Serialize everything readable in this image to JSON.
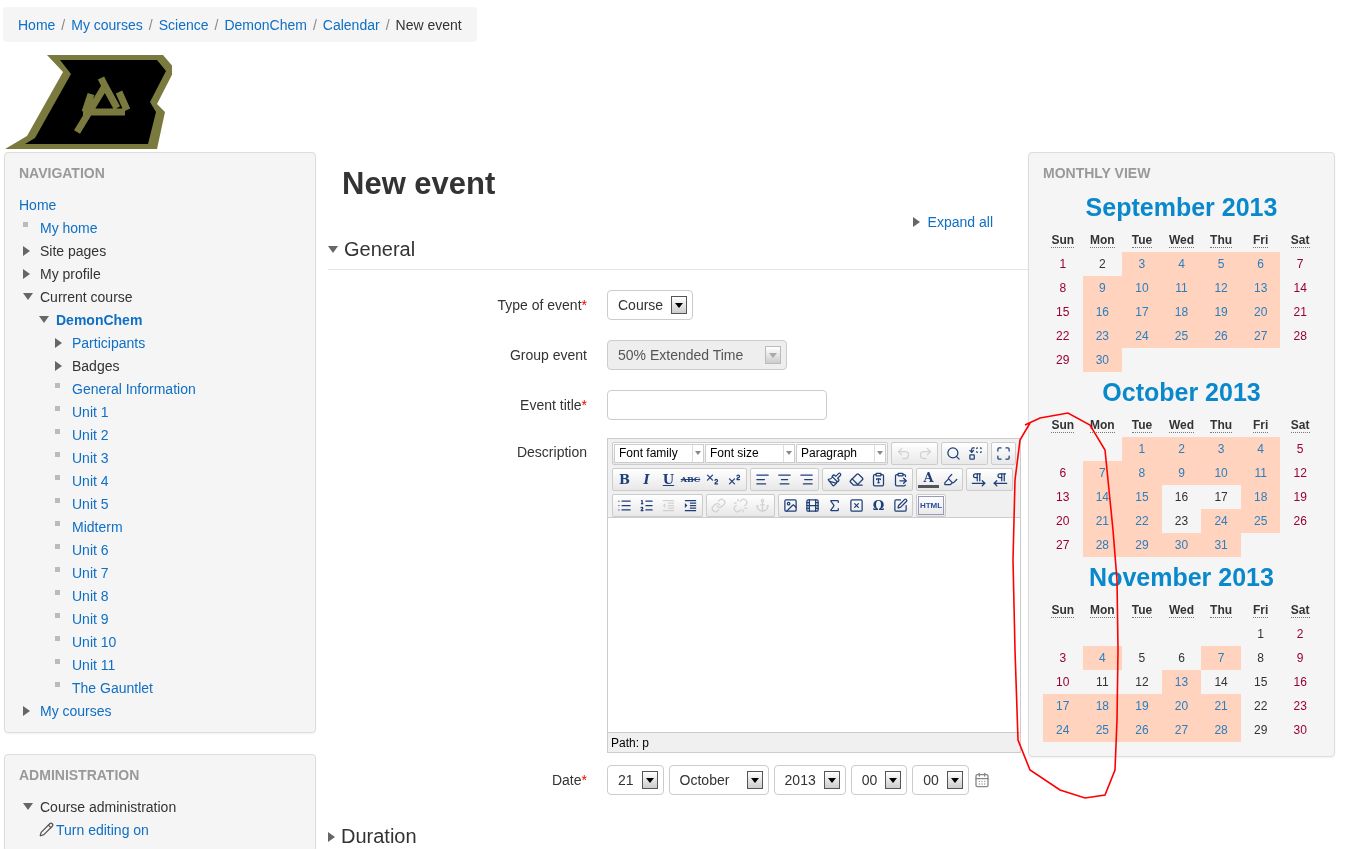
{
  "breadcrumb": {
    "separator": "/",
    "items": [
      {
        "label": "Home",
        "link": true
      },
      {
        "label": "My courses",
        "link": true
      },
      {
        "label": "Science",
        "link": true
      },
      {
        "label": "DemonChem",
        "link": true
      },
      {
        "label": "Calendar",
        "link": true
      },
      {
        "label": "New event",
        "link": false
      }
    ]
  },
  "navigation": {
    "title": "NAVIGATION",
    "items": [
      {
        "label": "Home",
        "link": true,
        "kind": "plain"
      },
      {
        "label": "My home",
        "link": true,
        "kind": "leaf"
      },
      {
        "label": "Site pages",
        "link": false,
        "kind": "branch",
        "expanded": false
      },
      {
        "label": "My profile",
        "link": false,
        "kind": "branch",
        "expanded": false
      },
      {
        "label": "Current course",
        "link": false,
        "kind": "branch",
        "expanded": true,
        "children": [
          {
            "label": "DemonChem",
            "link": true,
            "kind": "branch",
            "expanded": true,
            "children": [
              {
                "label": "Participants",
                "link": true,
                "kind": "branch",
                "expanded": false
              },
              {
                "label": "Badges",
                "link": false,
                "kind": "branch",
                "expanded": false
              },
              {
                "label": "General Information",
                "link": true,
                "kind": "leaf"
              },
              {
                "label": "Unit 1",
                "link": true,
                "kind": "leaf"
              },
              {
                "label": "Unit 2",
                "link": true,
                "kind": "leaf"
              },
              {
                "label": "Unit 3",
                "link": true,
                "kind": "leaf"
              },
              {
                "label": "Unit 4",
                "link": true,
                "kind": "leaf"
              },
              {
                "label": "Unit 5",
                "link": true,
                "kind": "leaf"
              },
              {
                "label": "Midterm",
                "link": true,
                "kind": "leaf"
              },
              {
                "label": "Unit 6",
                "link": true,
                "kind": "leaf"
              },
              {
                "label": "Unit 7",
                "link": true,
                "kind": "leaf"
              },
              {
                "label": "Unit 8",
                "link": true,
                "kind": "leaf"
              },
              {
                "label": "Unit 9",
                "link": true,
                "kind": "leaf"
              },
              {
                "label": "Unit 10",
                "link": true,
                "kind": "leaf"
              },
              {
                "label": "Unit 11",
                "link": true,
                "kind": "leaf"
              },
              {
                "label": "The Gauntlet",
                "link": true,
                "kind": "leaf"
              }
            ]
          }
        ]
      },
      {
        "label": "My courses",
        "link": true,
        "kind": "branch",
        "expanded": false
      }
    ]
  },
  "administration": {
    "title": "ADMINISTRATION",
    "items": [
      {
        "label": "Course administration",
        "link": false,
        "kind": "branch",
        "expanded": true,
        "children": [
          {
            "label": "Turn editing on",
            "link": true,
            "kind": "action"
          }
        ]
      }
    ]
  },
  "page_title": "New event",
  "expand_all": "Expand all",
  "general": {
    "title": "General",
    "expanded": true,
    "fields": [
      {
        "kind": "select",
        "label": "Type of event",
        "required_mark": "*",
        "value": "Course",
        "disabled": false
      },
      {
        "kind": "select",
        "label": "Group event",
        "value": "50% Extended Time",
        "disabled": true
      },
      {
        "kind": "text",
        "label": "Event title",
        "required_mark": "*"
      },
      {
        "kind": "editor",
        "label": "Description",
        "path": "Path: p",
        "toolbar": [
          [
            [
              {
                "kind": "dropdown",
                "label": "Font family",
                "disabled": false
              },
              {
                "kind": "dropdown",
                "label": "Font size",
                "disabled": false
              },
              {
                "kind": "dropdown",
                "label": "Paragraph",
                "disabled": false
              }
            ],
            [
              {
                "kind": "undo",
                "disabled": true
              },
              {
                "kind": "redo",
                "disabled": true
              }
            ],
            [
              {
                "kind": "find",
                "disabled": false
              },
              {
                "kind": "replace",
                "disabled": false
              }
            ],
            [
              {
                "kind": "fullscreen",
                "disabled": false
              }
            ]
          ],
          [
            [
              {
                "kind": "bold",
                "label": "B",
                "disabled": false
              },
              {
                "kind": "italic",
                "label": "I",
                "disabled": false
              },
              {
                "kind": "underline",
                "label": "U",
                "disabled": false
              },
              {
                "kind": "strike",
                "label": "ABC",
                "disabled": false
              },
              {
                "kind": "subscript",
                "disabled": false
              },
              {
                "kind": "superscript",
                "disabled": false
              }
            ],
            [
              {
                "kind": "align-left",
                "disabled": false
              },
              {
                "kind": "align-center",
                "disabled": false
              },
              {
                "kind": "align-right",
                "disabled": false
              }
            ],
            [
              {
                "kind": "cleanup",
                "disabled": false
              },
              {
                "kind": "eraser",
                "disabled": false
              },
              {
                "kind": "paste-text",
                "disabled": false
              },
              {
                "kind": "paste-word",
                "disabled": false
              }
            ],
            [
              {
                "kind": "forecolor",
                "label": "A",
                "disabled": false
              },
              {
                "kind": "highlight",
                "disabled": false
              }
            ],
            [
              {
                "kind": "ltr",
                "disabled": false
              },
              {
                "kind": "rtl",
                "disabled": false
              }
            ]
          ],
          [
            [
              {
                "kind": "bullets",
                "disabled": false
              },
              {
                "kind": "numbers",
                "disabled": false
              },
              {
                "kind": "outdent",
                "disabled": true
              },
              {
                "kind": "indent",
                "disabled": false
              }
            ],
            [
              {
                "kind": "link",
                "disabled": true
              },
              {
                "kind": "unlink",
                "disabled": true
              },
              {
                "kind": "anchor",
                "disabled": true
              }
            ],
            [
              {
                "kind": "image",
                "disabled": false
              },
              {
                "kind": "media",
                "disabled": false
              },
              {
                "kind": "equation",
                "disabled": false
              },
              {
                "kind": "nolink",
                "disabled": false
              },
              {
                "kind": "charmap",
                "label": "Ω",
                "disabled": false
              },
              {
                "kind": "edit",
                "disabled": false
              }
            ],
            [
              {
                "kind": "html",
                "label": "HTML",
                "disabled": false
              }
            ]
          ]
        ]
      },
      {
        "kind": "date",
        "label": "Date",
        "required_mark": "*",
        "parts": [
          "21",
          "October",
          "2013",
          "00",
          "00"
        ]
      }
    ]
  },
  "duration": {
    "title": "Duration",
    "expanded": false
  },
  "monthly_view": {
    "title": "MONTHLY VIEW",
    "months": [
      {
        "title": "September 2013",
        "weekdays": [
          "Sun",
          "Mon",
          "Tue",
          "Wed",
          "Thu",
          "Fri",
          "Sat"
        ],
        "weeks": [
          [
            {
              "day": "1",
              "event": false
            },
            {
              "day": "2",
              "event": false
            },
            {
              "day": "3",
              "event": true
            },
            {
              "day": "4",
              "event": true
            },
            {
              "day": "5",
              "event": true
            },
            {
              "day": "6",
              "event": true
            },
            {
              "day": "7",
              "event": false
            }
          ],
          [
            {
              "day": "8",
              "event": false
            },
            {
              "day": "9",
              "event": true
            },
            {
              "day": "10",
              "event": true
            },
            {
              "day": "11",
              "event": true
            },
            {
              "day": "12",
              "event": true
            },
            {
              "day": "13",
              "event": true
            },
            {
              "day": "14",
              "event": false
            }
          ],
          [
            {
              "day": "15",
              "event": false
            },
            {
              "day": "16",
              "event": true
            },
            {
              "day": "17",
              "event": true
            },
            {
              "day": "18",
              "event": true
            },
            {
              "day": "19",
              "event": true
            },
            {
              "day": "20",
              "event": true
            },
            {
              "day": "21",
              "event": false
            }
          ],
          [
            {
              "day": "22",
              "event": false
            },
            {
              "day": "23",
              "event": true
            },
            {
              "day": "24",
              "event": true
            },
            {
              "day": "25",
              "event": true
            },
            {
              "day": "26",
              "event": true
            },
            {
              "day": "27",
              "event": true
            },
            {
              "day": "28",
              "event": false
            }
          ],
          [
            {
              "day": "29",
              "event": false
            },
            {
              "day": "30",
              "event": true
            }
          ]
        ]
      },
      {
        "title": "October 2013",
        "weekdays": [
          "Sun",
          "Mon",
          "Tue",
          "Wed",
          "Thu",
          "Fri",
          "Sat"
        ],
        "weeks": [
          [
            {
              "day": "1",
              "event": true
            },
            {
              "day": "2",
              "event": true
            },
            {
              "day": "3",
              "event": true
            },
            {
              "day": "4",
              "event": true
            },
            {
              "day": "5",
              "event": false
            }
          ],
          [
            {
              "day": "6",
              "event": false
            },
            {
              "day": "7",
              "event": true
            },
            {
              "day": "8",
              "event": true
            },
            {
              "day": "9",
              "event": true
            },
            {
              "day": "10",
              "event": true
            },
            {
              "day": "11",
              "event": true
            },
            {
              "day": "12",
              "event": false
            }
          ],
          [
            {
              "day": "13",
              "event": false
            },
            {
              "day": "14",
              "event": true
            },
            {
              "day": "15",
              "event": true
            },
            {
              "day": "16",
              "event": false
            },
            {
              "day": "17",
              "event": false
            },
            {
              "day": "18",
              "event": true
            },
            {
              "day": "19",
              "event": false
            }
          ],
          [
            {
              "day": "20",
              "event": false
            },
            {
              "day": "21",
              "event": true
            },
            {
              "day": "22",
              "event": true
            },
            {
              "day": "23",
              "event": false
            },
            {
              "day": "24",
              "event": true
            },
            {
              "day": "25",
              "event": true
            },
            {
              "day": "26",
              "event": false
            }
          ],
          [
            {
              "day": "27",
              "event": false
            },
            {
              "day": "28",
              "event": true
            },
            {
              "day": "29",
              "event": true
            },
            {
              "day": "30",
              "event": true
            },
            {
              "day": "31",
              "event": true
            }
          ]
        ]
      },
      {
        "title": "November 2013",
        "weekdays": [
          "Sun",
          "Mon",
          "Tue",
          "Wed",
          "Thu",
          "Fri",
          "Sat"
        ],
        "weeks": [
          [
            {
              "day": "1",
              "event": false
            },
            {
              "day": "2",
              "event": false
            }
          ],
          [
            {
              "day": "3",
              "event": false
            },
            {
              "day": "4",
              "event": true
            },
            {
              "day": "5",
              "event": false
            },
            {
              "day": "6",
              "event": false
            },
            {
              "day": "7",
              "event": true
            },
            {
              "day": "8",
              "event": false
            },
            {
              "day": "9",
              "event": false
            }
          ],
          [
            {
              "day": "10",
              "event": false
            },
            {
              "day": "11",
              "event": false
            },
            {
              "day": "12",
              "event": false
            },
            {
              "day": "13",
              "event": true
            },
            {
              "day": "14",
              "event": false
            },
            {
              "day": "15",
              "event": false
            },
            {
              "day": "16",
              "event": false
            }
          ],
          [
            {
              "day": "17",
              "event": true
            },
            {
              "day": "18",
              "event": true
            },
            {
              "day": "19",
              "event": true
            },
            {
              "day": "20",
              "event": true
            },
            {
              "day": "21",
              "event": true
            },
            {
              "day": "22",
              "event": false
            },
            {
              "day": "23",
              "event": false
            }
          ],
          [
            {
              "day": "24",
              "event": true
            },
            {
              "day": "25",
              "event": true
            },
            {
              "day": "26",
              "event": true
            },
            {
              "day": "27",
              "event": true
            },
            {
              "day": "28",
              "event": true
            },
            {
              "day": "29",
              "event": false
            },
            {
              "day": "30",
              "event": false
            }
          ]
        ]
      }
    ]
  }
}
